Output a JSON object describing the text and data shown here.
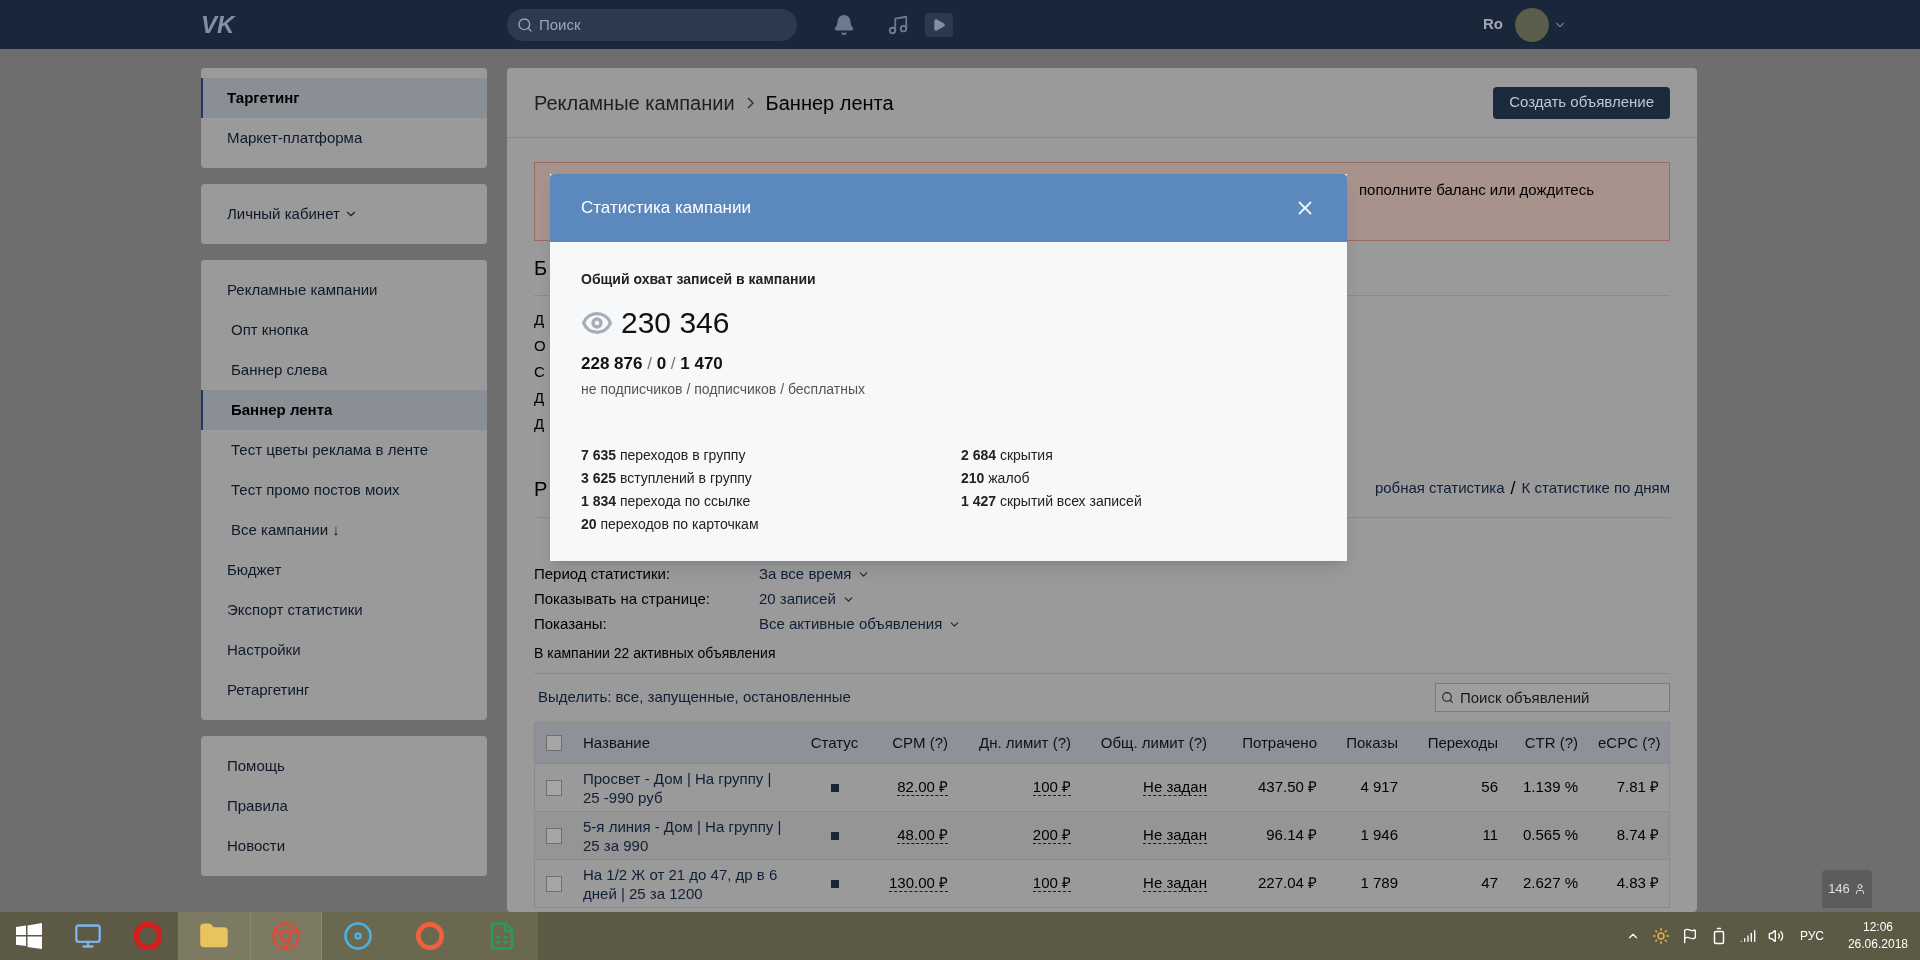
{
  "topbar": {
    "logo": "VK",
    "search_placeholder": "Поиск",
    "user": "Ro"
  },
  "sidebar": {
    "groups": [
      {
        "items": [
          {
            "label": "Таргетинг",
            "kind": "item",
            "selected": true
          },
          {
            "label": "Маркет-платформа",
            "kind": "item",
            "selected": false
          }
        ]
      },
      {
        "items": [
          {
            "label": "Личный кабинет",
            "kind": "dropdown",
            "selected": false
          }
        ]
      },
      {
        "items": [
          {
            "label": "Рекламные кампании",
            "kind": "item",
            "selected": false
          },
          {
            "label": "Опт кнопка",
            "kind": "subitem",
            "selected": false
          },
          {
            "label": "Баннер слева",
            "kind": "subitem",
            "selected": false
          },
          {
            "label": "Баннер лента",
            "kind": "subitem",
            "selected": true
          },
          {
            "label": "Тест цветы реклама в ленте",
            "kind": "subitem",
            "selected": false
          },
          {
            "label": "Тест промо постов моих",
            "kind": "subitem",
            "selected": false
          },
          {
            "label": "Все кампании ↓",
            "kind": "subitem",
            "selected": false
          },
          {
            "label": "Бюджет",
            "kind": "item",
            "selected": false
          },
          {
            "label": "Экспорт статистики",
            "kind": "item",
            "selected": false
          },
          {
            "label": "Настройки",
            "kind": "item",
            "selected": false
          },
          {
            "label": "Ретаргетинг",
            "kind": "item",
            "selected": false
          }
        ]
      },
      {
        "items": [
          {
            "label": "Помощь",
            "kind": "item",
            "selected": false
          },
          {
            "label": "Правила",
            "kind": "item",
            "selected": false
          },
          {
            "label": "Новости",
            "kind": "item",
            "selected": false
          }
        ]
      }
    ]
  },
  "main": {
    "breadcrumb": [
      "Рекламные кампании",
      "Баннер лента"
    ],
    "create_button": "Создать объявление",
    "alert_fragment": "пополните баланс или дождитесь",
    "section_fragment": "Б",
    "info_fragments": [
      "Д",
      "О",
      "С",
      "Д",
      "Д"
    ],
    "stats_section_fragment": "Р",
    "stats_links": [
      "робная статистика",
      "К статистике по дням"
    ],
    "stats_link_separator": "/",
    "filters": [
      {
        "label": "Период статистики:",
        "value": "За все время"
      },
      {
        "label": "Показывать на странице:",
        "value": "20 записей"
      },
      {
        "label": "Показаны:",
        "value": "Все активные объявления"
      }
    ],
    "ads_count": "В кампании 22 активных объявления",
    "select_text": "Выделить: все, запущенные, остановленные",
    "ads_search_placeholder": "Поиск объявлений",
    "table": {
      "select_all_checked": false,
      "columns": [
        "Название",
        "Статус",
        "CPM (?)",
        "Дн. лимит (?)",
        "Общ. лимит (?)",
        "Потрачено",
        "Показы",
        "Переходы",
        "CTR (?)",
        "eCPC (?)"
      ],
      "rows": [
        {
          "checked": false,
          "cells": [
            "Просвет - Дом | На группу | 25 -990 руб",
            "",
            "82.00 ₽",
            "100 ₽",
            "Не задан",
            "437.50 ₽",
            "4 917",
            "56",
            "1.139 %",
            "7.81 ₽"
          ]
        },
        {
          "checked": false,
          "cells": [
            "5-я линия - Дом | На группу | 25 за 990",
            "",
            "48.00 ₽",
            "200 ₽",
            "Не задан",
            "96.14 ₽",
            "1 946",
            "11",
            "0.565 %",
            "8.74 ₽"
          ]
        },
        {
          "checked": false,
          "cells": [
            "На 1/2 Ж от 21 до 47, др в 6 дней | 25 за 1200",
            "",
            "130.00 ₽",
            "100 ₽",
            "Не задан",
            "227.04 ₽",
            "1 789",
            "47",
            "2.627 %",
            "4.83 ₽"
          ]
        }
      ]
    }
  },
  "modal": {
    "title": "Статистика кампании",
    "reach_label": "Общий охват записей в кампании",
    "reach_total": "230 346",
    "reach_split": "**228 876** / **0** / **1 470**",
    "reach_legend": "не подписчиков / подписчиков / бесплатных",
    "stats_left": [
      "**7 635** переходов в группу",
      "**3 625** вступлений в группу",
      "**1 834** перехода по ссылке",
      "**20** переходов по карточкам"
    ],
    "stats_right": [
      "**2 684** скрытия",
      "**210** жалоб",
      "**1 427** скрытий всех записей"
    ]
  },
  "online_badge": "146",
  "taskbar": {
    "language": "РУС",
    "time": "12:06",
    "date": "26.06.2018"
  }
}
